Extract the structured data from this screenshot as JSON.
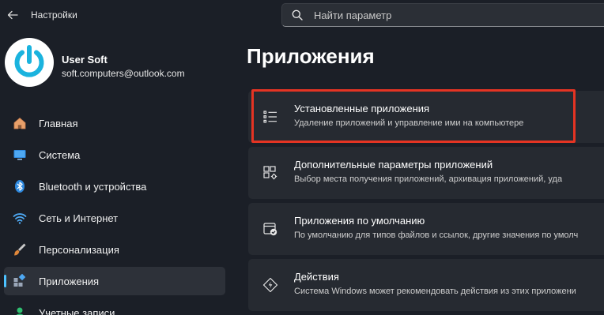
{
  "window": {
    "title": "Настройки"
  },
  "search": {
    "placeholder": "Найти параметр"
  },
  "user": {
    "name": "User Soft",
    "email": "soft.computers@outlook.com"
  },
  "nav": {
    "items": [
      {
        "label": "Главная",
        "icon": "home-icon"
      },
      {
        "label": "Система",
        "icon": "system-icon"
      },
      {
        "label": "Bluetooth и устройства",
        "icon": "bluetooth-icon"
      },
      {
        "label": "Сеть и Интернет",
        "icon": "network-icon"
      },
      {
        "label": "Персонализация",
        "icon": "brush-icon"
      },
      {
        "label": "Приложения",
        "icon": "apps-icon",
        "active": true
      },
      {
        "label": "Учетные записи",
        "icon": "accounts-icon"
      }
    ]
  },
  "main": {
    "title": "Приложения",
    "cards": [
      {
        "title": "Установленные приложения",
        "subtitle": "Удаление приложений и управление ими на компьютере",
        "icon": "list-icon",
        "highlighted": true
      },
      {
        "title": "Дополнительные параметры приложений",
        "subtitle": "Выбор места получения приложений, архивация приложений, уда",
        "icon": "app-settings-icon"
      },
      {
        "title": "Приложения по умолчанию",
        "subtitle": "По умолчанию для типов файлов и ссылок, другие значения по умолч",
        "icon": "default-apps-icon"
      },
      {
        "title": "Действия",
        "subtitle": "Система Windows может рекомендовать действия из этих приложени",
        "icon": "actions-icon"
      }
    ]
  },
  "colors": {
    "background": "#1b1f27",
    "card": "#262a31",
    "accent": "#4cc2ff",
    "highlight": "#e53423"
  }
}
